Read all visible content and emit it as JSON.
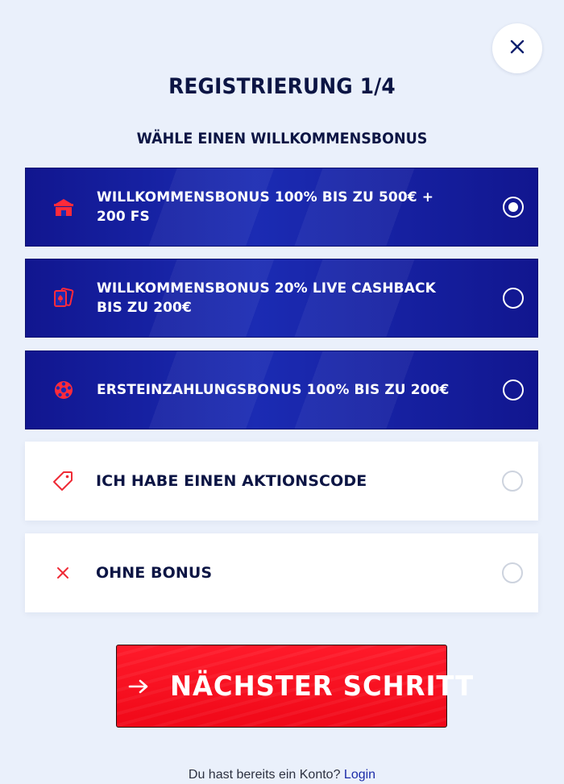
{
  "header": {
    "title": "REGISTRIERUNG 1/4",
    "subtitle": "WÄHLE EINEN WILLKOMMENSBONUS",
    "close_icon": "close-icon"
  },
  "options": [
    {
      "label": "WILLKOMMENSBONUS 100% BIS ZU 500€ + 200 FS",
      "icon": "casino-icon",
      "selected": true,
      "style": "dark"
    },
    {
      "label": "WILLKOMMENSBONUS 20% LIVE CASHBACK BIS ZU 200€",
      "icon": "cards-icon",
      "selected": false,
      "style": "dark"
    },
    {
      "label": "ERSTEINZAHLUNGSBONUS 100% BIS ZU 200€",
      "icon": "sports-ball-icon",
      "selected": false,
      "style": "dark"
    },
    {
      "label": "ICH HABE EINEN AKTIONSCODE",
      "icon": "tag-icon",
      "selected": false,
      "style": "light"
    },
    {
      "label": "OHNE BONUS",
      "icon": "close-icon",
      "selected": false,
      "style": "light"
    }
  ],
  "next_button": {
    "label": "NÄCHSTER SCHRITT",
    "icon": "arrow-right-icon"
  },
  "footer": {
    "text": "Du hast bereits ein Konto?",
    "link": "Login"
  },
  "colors": {
    "background": "#eaf0fb",
    "navy_text": "#0c1544",
    "option_dark": "#1b2bb3",
    "accent_red": "#f00818",
    "link": "#1b2ba8"
  }
}
